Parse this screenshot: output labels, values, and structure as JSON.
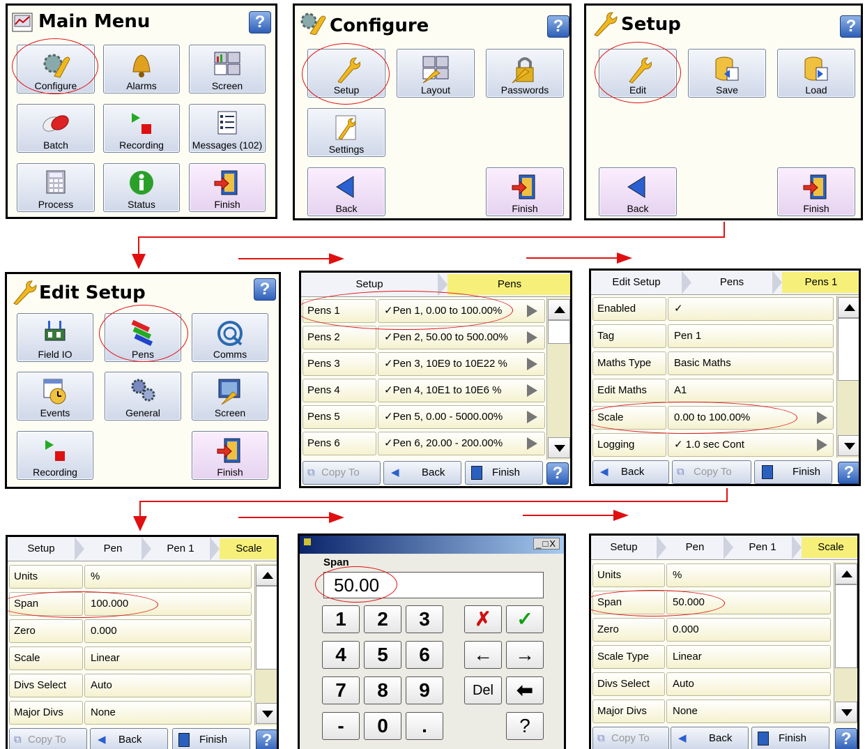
{
  "main_menu": {
    "title": "Main Menu",
    "help": "?",
    "buttons": [
      "Configure",
      "Alarms",
      "Screen",
      "Batch",
      "Recording",
      "Messages (102)",
      "Process",
      "Status",
      "Finish"
    ]
  },
  "configure": {
    "title": "Configure",
    "help": "?",
    "buttons": [
      "Setup",
      "Layout",
      "Passwords",
      "Settings",
      "Back",
      "Finish"
    ]
  },
  "setup": {
    "title": "Setup",
    "help": "?",
    "buttons": [
      "Edit",
      "Save",
      "Load",
      "Back",
      "Finish"
    ]
  },
  "edit_setup": {
    "title": "Edit Setup",
    "help": "?",
    "buttons": [
      "Field IO",
      "Pens",
      "Comms",
      "Events",
      "General",
      "Screen",
      "Recording",
      "Finish"
    ]
  },
  "pens_list": {
    "tabs": [
      "Setup",
      "Pens"
    ],
    "rows": [
      {
        "label": "Pens 1",
        "value": "✓Pen 1, 0.00 to 100.00%"
      },
      {
        "label": "Pens 2",
        "value": "✓Pen 2, 50.00 to 500.00%"
      },
      {
        "label": "Pens 3",
        "value": "✓Pen 3, 10E9 to 10E22 %"
      },
      {
        "label": "Pens 4",
        "value": "✓Pen 4, 10E1 to 10E6 %"
      },
      {
        "label": "Pens 5",
        "value": "✓Pen 5, 0.00 - 5000.00%"
      },
      {
        "label": "Pens 6",
        "value": "✓Pen 6, 20.00 - 200.00%"
      }
    ],
    "bottom": [
      "Copy To",
      "Back",
      "Finish"
    ]
  },
  "pen1": {
    "tabs": [
      "Edit Setup",
      "Pens",
      "Pens 1"
    ],
    "rows": [
      {
        "label": "Enabled",
        "value": "✓"
      },
      {
        "label": "Tag",
        "value": "Pen 1"
      },
      {
        "label": "Maths Type",
        "value": "Basic Maths"
      },
      {
        "label": "Edit Maths",
        "value": "A1"
      },
      {
        "label": "Scale",
        "value": "0.00 to 100.00%"
      },
      {
        "label": "Logging",
        "value": "✓  1.0 sec Cont"
      }
    ],
    "bottom": [
      "Back",
      "Copy To",
      "Finish"
    ]
  },
  "scale1": {
    "tabs": [
      "Setup",
      "Pen",
      "Pen 1",
      "Scale"
    ],
    "rows": [
      {
        "label": "Units",
        "value": "%"
      },
      {
        "label": "Span",
        "value": "100.000"
      },
      {
        "label": "Zero",
        "value": "0.000"
      },
      {
        "label": "Scale",
        "value": "Linear"
      },
      {
        "label": "Divs Select",
        "value": "Auto"
      },
      {
        "label": "Major Divs",
        "value": "None"
      }
    ],
    "bottom": [
      "Copy To",
      "Back",
      "Finish"
    ]
  },
  "keypad": {
    "field_label": "Span",
    "value": "50.00",
    "window_buttons": "_□X",
    "keys": [
      "1",
      "2",
      "3",
      "4",
      "5",
      "6",
      "7",
      "8",
      "9",
      "-",
      "0",
      "."
    ],
    "side_keys": [
      "✗",
      "✓",
      "←",
      "→",
      "Del",
      "⬅",
      "?"
    ]
  },
  "scale2": {
    "tabs": [
      "Setup",
      "Pen",
      "Pen 1",
      "Scale"
    ],
    "rows": [
      {
        "label": "Units",
        "value": "%"
      },
      {
        "label": "Span",
        "value": "50.000"
      },
      {
        "label": "Zero",
        "value": "0.000"
      },
      {
        "label": "Scale Type",
        "value": "Linear"
      },
      {
        "label": "Divs Select",
        "value": "Auto"
      },
      {
        "label": "Major Divs",
        "value": "None"
      }
    ],
    "bottom": [
      "Copy To",
      "Back",
      "Finish"
    ]
  }
}
